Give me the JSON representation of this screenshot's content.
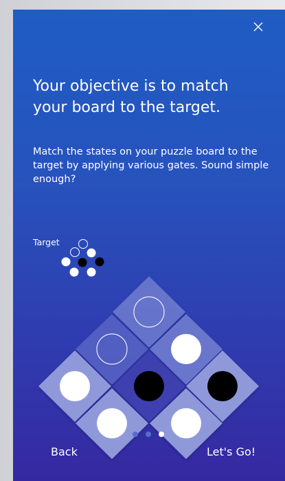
{
  "colors": {
    "background_top": "#1f5cc4",
    "background_bottom": "#3628a0",
    "tile_light": "#8d97d6",
    "tile_dark": "#4550b5",
    "tile_darker": "#3c3fb0",
    "active_dot": "#ffffff",
    "inactive_dot": "#5a6cc8"
  },
  "header": {
    "close_icon": "close-icon"
  },
  "content": {
    "title": "Your objective is to match your board to the target.",
    "description": "Match the states on your puzzle board to the target by applying various gates. Sound simple enough?"
  },
  "target": {
    "label": "Target"
  },
  "pagination": {
    "total": 3,
    "active_index": 2
  },
  "footer": {
    "back_label": "Back",
    "next_label": "Let's Go!"
  }
}
